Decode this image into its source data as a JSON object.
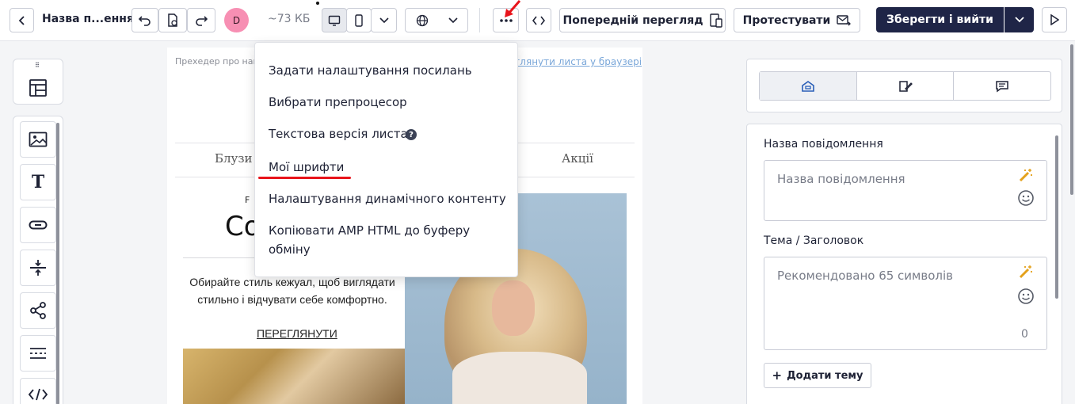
{
  "toolbar": {
    "title": "Назва п...ення",
    "avatar_letter": "D",
    "size": "~73 КБ",
    "preview_label": "Попередній перегляд",
    "test_label": "Протестувати",
    "save_label": "Зберегти і вийти"
  },
  "menu": {
    "items": [
      "Задати налаштування посилань",
      "Вибрати препроцесор",
      "Текстова версія листа",
      "Мої шрифти",
      "Налаштування динамічного контенту",
      "Копіювати AMP HTML до буферу",
      "обміну"
    ]
  },
  "email": {
    "preheader": "Прехедер про най",
    "view_link": "глянути листа у браузері",
    "nav_left": "Блузи",
    "nav_right": "Акції",
    "small_caps": "F",
    "big_title": "Co",
    "body_text_1": "Обирайте стиль кежуал, щоб виглядати",
    "body_text_2": "стильно і відчувати себе комфортно.",
    "cta": "ПЕРЕГЛЯНУТИ"
  },
  "settings": {
    "name_label": "Назва повідомлення",
    "name_placeholder": "Назва повідомлення",
    "subject_label": "Тема / Заголовок",
    "subject_placeholder": "Рекомендовано 65 символів",
    "char_count": "0",
    "add_subject": "Додати тему"
  },
  "colors": {
    "primary": "#1f2547",
    "avatar": "#f78fb3",
    "annotation_red": "#e8141b",
    "link": "#7aa7d9"
  }
}
